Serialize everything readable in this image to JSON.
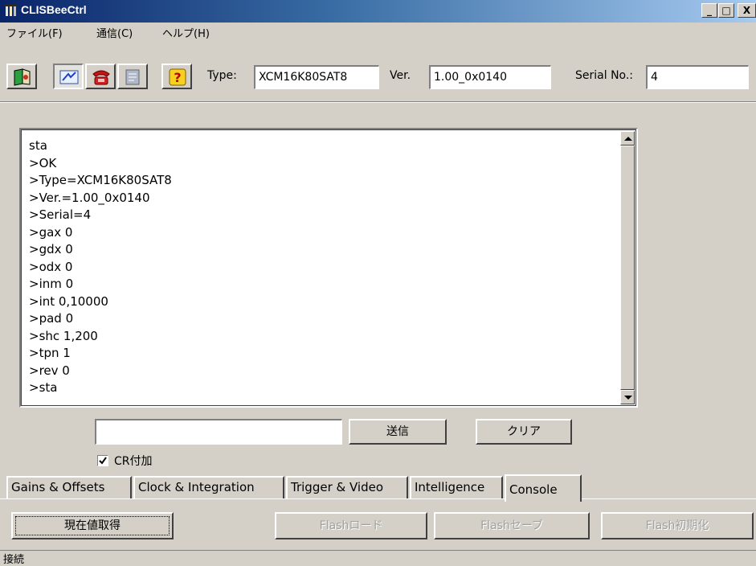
{
  "window": {
    "title": "CLISBeeCtrl",
    "minimize_label": "_",
    "maximize_label": "□",
    "close_label": "X"
  },
  "menu": {
    "items": [
      {
        "label": "ファイル(F)"
      },
      {
        "label": "通信(C)"
      },
      {
        "label": "ヘルプ(H)"
      }
    ]
  },
  "toolbar": {
    "icons": [
      "connect-icon",
      "port-icon",
      "phone-icon",
      "document-icon",
      "help-icon"
    ],
    "help_glyph": "?",
    "type_label": "Type:",
    "type_value": "XCM16K80SAT8",
    "ver_label": "Ver.",
    "ver_value": "1.00_0x0140",
    "serial_label": "Serial No.:",
    "serial_value": "4"
  },
  "console": {
    "lines": [
      "sta",
      ">OK",
      ">Type=XCM16K80SAT8",
      ">Ver.=1.00_0x0140",
      ">Serial=4",
      ">gax 0",
      ">gdx 0",
      ">odx 0",
      ">inm 0",
      ">int 0,10000",
      ">pad 0",
      ">shc 1,200",
      ">tpn 1",
      ">rev 0",
      ">sta"
    ],
    "input_value": "",
    "send_label": "送信",
    "clear_label": "クリア",
    "cr_label": "CR付加",
    "cr_checked": true
  },
  "tabs": [
    {
      "label": "Gains & Offsets"
    },
    {
      "label": "Clock & Integration"
    },
    {
      "label": "Trigger & Video"
    },
    {
      "label": "Intelligence"
    },
    {
      "label": "Console",
      "active": true
    }
  ],
  "actions": {
    "current_label": "現在値取得",
    "flash_load_label": "Flashロード",
    "flash_save_label": "Flashセーブ",
    "flash_init_label": "Flash初期化"
  },
  "status": {
    "text": "接続"
  }
}
